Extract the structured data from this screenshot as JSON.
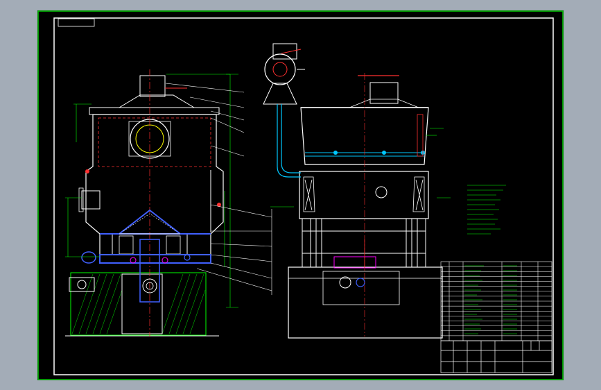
{
  "drawing": {
    "frame_label": "",
    "top_left_box_label": "",
    "colors": {
      "background_outer": "#a3acb7",
      "sheet": "#000000",
      "border_outer": "#00c800",
      "border_inner": "#ffffff",
      "outline": "#ffffff",
      "dimension": "#00ff00",
      "hidden": "#ff3030",
      "blue_parts": "#4060ff",
      "magenta": "#ff00ff",
      "cyan": "#00c8ff",
      "yellow": "#ffff00",
      "hatch_green": "#00b000"
    }
  },
  "views": {
    "left": {
      "name": "section-view"
    },
    "right": {
      "name": "elevation-view"
    }
  },
  "notes": {
    "heading": "",
    "lines": [
      "",
      "",
      "",
      "",
      "",
      "",
      "",
      "",
      "",
      ""
    ]
  },
  "parts_table": {
    "rows": 16,
    "columns": 5
  },
  "title_block": {
    "drawing_title": "",
    "scale": "",
    "sheet": ""
  }
}
